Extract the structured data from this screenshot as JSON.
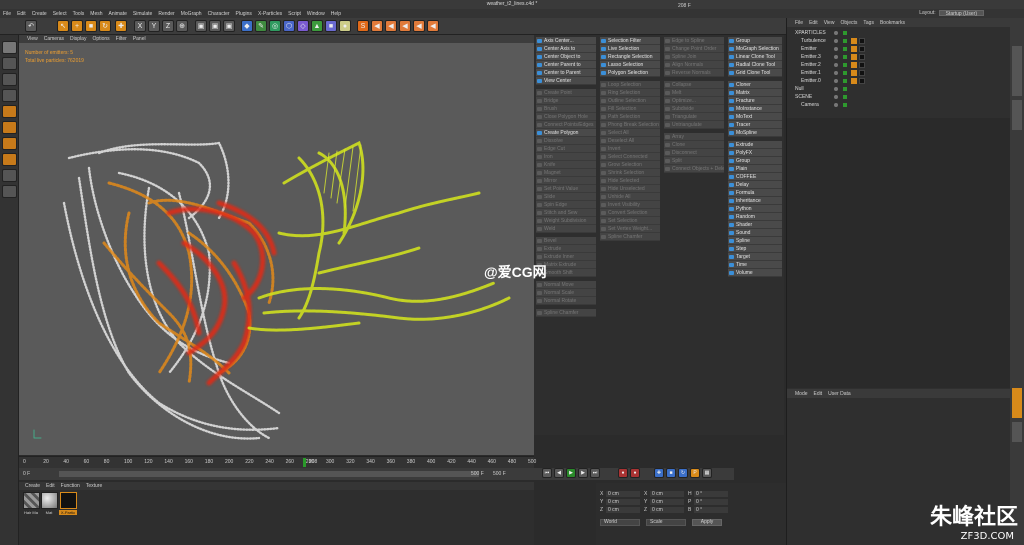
{
  "window": {
    "title": "weather_t2_lines.c4d *"
  },
  "menubar": [
    "File",
    "Edit",
    "Create",
    "Select",
    "Tools",
    "Mesh",
    "Animate",
    "Simulate",
    "Render",
    "MoGraph",
    "Character",
    "Plugins",
    "X-Particles",
    "Script",
    "Window",
    "Help"
  ],
  "layout": {
    "label": "Layout:",
    "value": "Startup (User)"
  },
  "viewport": {
    "menu": [
      "View",
      "Cameras",
      "Display",
      "Options",
      "Filter",
      "Panel"
    ],
    "hud_emitters": "Number of emitters: 5",
    "hud_particles": "Total live particles: 762019"
  },
  "timeline": {
    "ticks": [
      "0",
      "20",
      "40",
      "60",
      "80",
      "100",
      "120",
      "140",
      "160",
      "180",
      "200",
      "220",
      "240",
      "260",
      "280",
      "300",
      "320",
      "340",
      "360",
      "380",
      "400",
      "420",
      "440",
      "460",
      "480",
      "500"
    ],
    "current": "208",
    "current_full": "208 F",
    "start": "0 F",
    "end": "500 F",
    "end2": "500 F"
  },
  "material": {
    "menu": [
      "Create",
      "Edit",
      "Function",
      "Texture"
    ],
    "items": [
      "Hair Ma",
      "Mat",
      "X-Partic"
    ]
  },
  "menus": {
    "col1": [
      "Axis Center...",
      "Center Axis to",
      "Center Object to",
      "Center Parent to",
      "Center to Parent",
      "View Center",
      "",
      "Create Point",
      "Bridge",
      "Brush",
      "Close Polygon Hole",
      "Connect Points/Edges",
      "Create Polygon",
      "Dissolve",
      "Edge Cut",
      "Iron",
      "Knife",
      "Magnet",
      "Mirror",
      "Set Point Value",
      "Slide",
      "Spin Edge",
      "Stitch and Sew",
      "Weight Subdivision",
      "Weld",
      "",
      "Bevel",
      "Extrude",
      "Extrude Inner",
      "Matrix Extrude",
      "Smooth Shift",
      "",
      "Normal Move",
      "Normal Scale",
      "Normal Rotate",
      "",
      "Spline Chamfer"
    ],
    "col2": [
      "Selection Filter",
      "Live Selection",
      "Rectangle Selection",
      "Lasso Selection",
      "Polygon Selection",
      "",
      "Loop Selection",
      "Ring Selection",
      "Outline Selection",
      "Fill Selection",
      "Path Selection",
      "Phong Break Selection",
      "Select All",
      "Deselect All",
      "Invert",
      "Select Connected",
      "Grow Selection",
      "Shrink Selection",
      "Hide Selected",
      "Hide Unselected",
      "Unhide All",
      "Invert Visibility",
      "Convert Selection",
      "Set Selection",
      "Set Vertex Weight...",
      "Spline Chamfer"
    ],
    "col3": [
      "Edge to Spline",
      "Change Point Order",
      "Spline Join",
      "Align Normals",
      "Reverse Normals",
      "",
      "Collapse",
      "Melt",
      "Optimize...",
      "Subdivide",
      "Triangulate",
      "Untriangulate",
      "",
      "Array",
      "Clone",
      "Disconnect",
      "Split",
      "Connect Objects + Delete"
    ],
    "col4": [
      "Group",
      "MoGraph Selection",
      "Linear Clone Tool",
      "Radial Clone Tool",
      "Grid Clone Tool",
      "",
      "Cloner",
      "Matrix",
      "Fracture",
      "MoInstance",
      "MoText",
      "Tracer",
      "MoSpline",
      "",
      "Extrude",
      "PolyFX",
      "Group",
      "Plain",
      "COFFEE",
      "Delay",
      "Formula",
      "Inheritance",
      "Python",
      "Random",
      "Shader",
      "Sound",
      "Spline",
      "Step",
      "Target",
      "Time",
      "Volume"
    ]
  },
  "objects": {
    "menu": [
      "File",
      "Edit",
      "View",
      "Objects",
      "Tags",
      "Bookmarks"
    ],
    "items": [
      "XPARTICLES",
      "Turbulence",
      "Emitter",
      "Emitter.3",
      "Emitter.2",
      "Emitter.1",
      "Emitter.0",
      "Null",
      "SCENE",
      "Camera"
    ]
  },
  "attributes": {
    "menu": [
      "Mode",
      "Edit",
      "User Data"
    ]
  },
  "coords": {
    "rows": [
      [
        "X",
        "0 cm",
        "X",
        "0 cm",
        "H",
        "0 °"
      ],
      [
        "Y",
        "0 cm",
        "Y",
        "0 cm",
        "P",
        "0 °"
      ],
      [
        "Z",
        "0 cm",
        "Z",
        "0 cm",
        "B",
        "0 °"
      ]
    ],
    "mode1": "World",
    "mode2": "Scale",
    "apply": "Apply"
  },
  "watermark": {
    "center": "@爱CG网",
    "brand": "朱峰社区",
    "site": "ZF3D.COM"
  }
}
